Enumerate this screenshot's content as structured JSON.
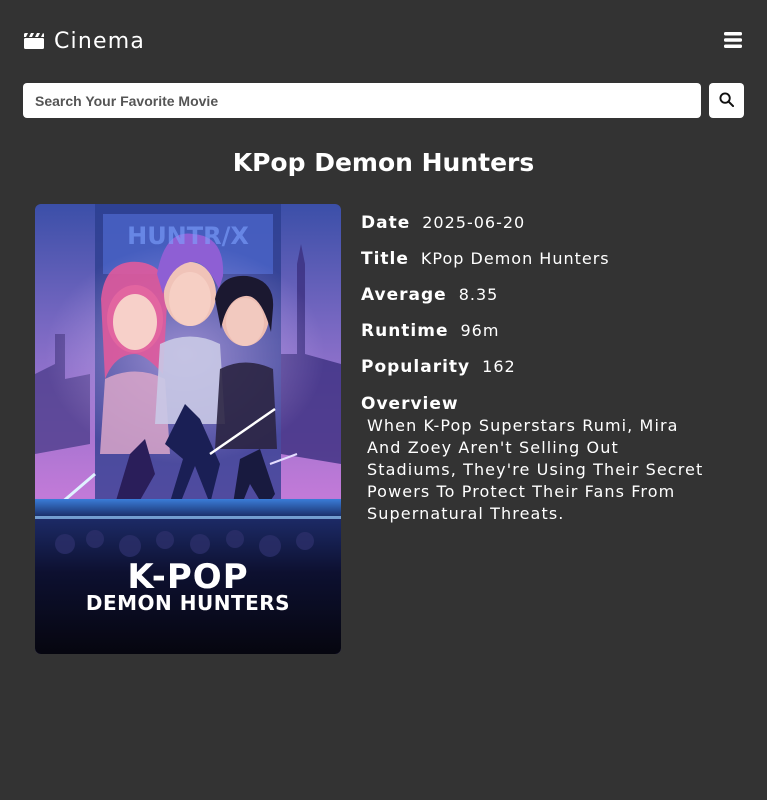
{
  "app": {
    "brand_name": "Cinema",
    "brand_icon": "clapperboard-icon",
    "menu_icon": "hamburger-menu-icon"
  },
  "search": {
    "placeholder": "Search Your Favorite Movie",
    "value": "",
    "button_icon": "search-icon"
  },
  "movie": {
    "heading": "KPop Demon Hunters",
    "poster_title_line1": "K-POP",
    "poster_title_line2": "DEMON HUNTERS",
    "poster_sign_text": "HUNTR/X",
    "fields": [
      {
        "label": "Date",
        "value": "2025-06-20"
      },
      {
        "label": "Title",
        "value": "KPop Demon Hunters"
      },
      {
        "label": "Average",
        "value": "8.35"
      },
      {
        "label": "Runtime",
        "value": "96m"
      },
      {
        "label": "Popularity",
        "value": "162"
      }
    ],
    "overview_label": "Overview",
    "overview_text": "When K-Pop Superstars Rumi, Mira And Zoey Aren't Selling Out Stadiums, They're Using Their Secret Powers To Protect Their Fans From Supernatural Threats."
  },
  "colors": {
    "background": "#333333",
    "text": "#ffffff",
    "input_bg": "#ffffff"
  }
}
